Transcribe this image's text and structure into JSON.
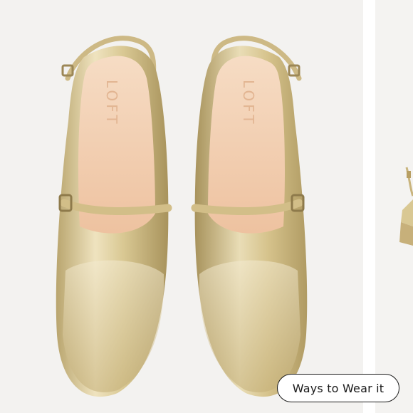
{
  "product_image": {
    "brand_stamp": "LOFT",
    "alt_description_icon": "gold-slingback-shoes-photo"
  },
  "carousel": {
    "ways_to_wear_label": "Ways to Wear it"
  },
  "colors": {
    "background": "#f3f2f0",
    "gold": "#d8c79a",
    "lining": "#f3cfb0",
    "button_border": "#1a1a1a"
  }
}
